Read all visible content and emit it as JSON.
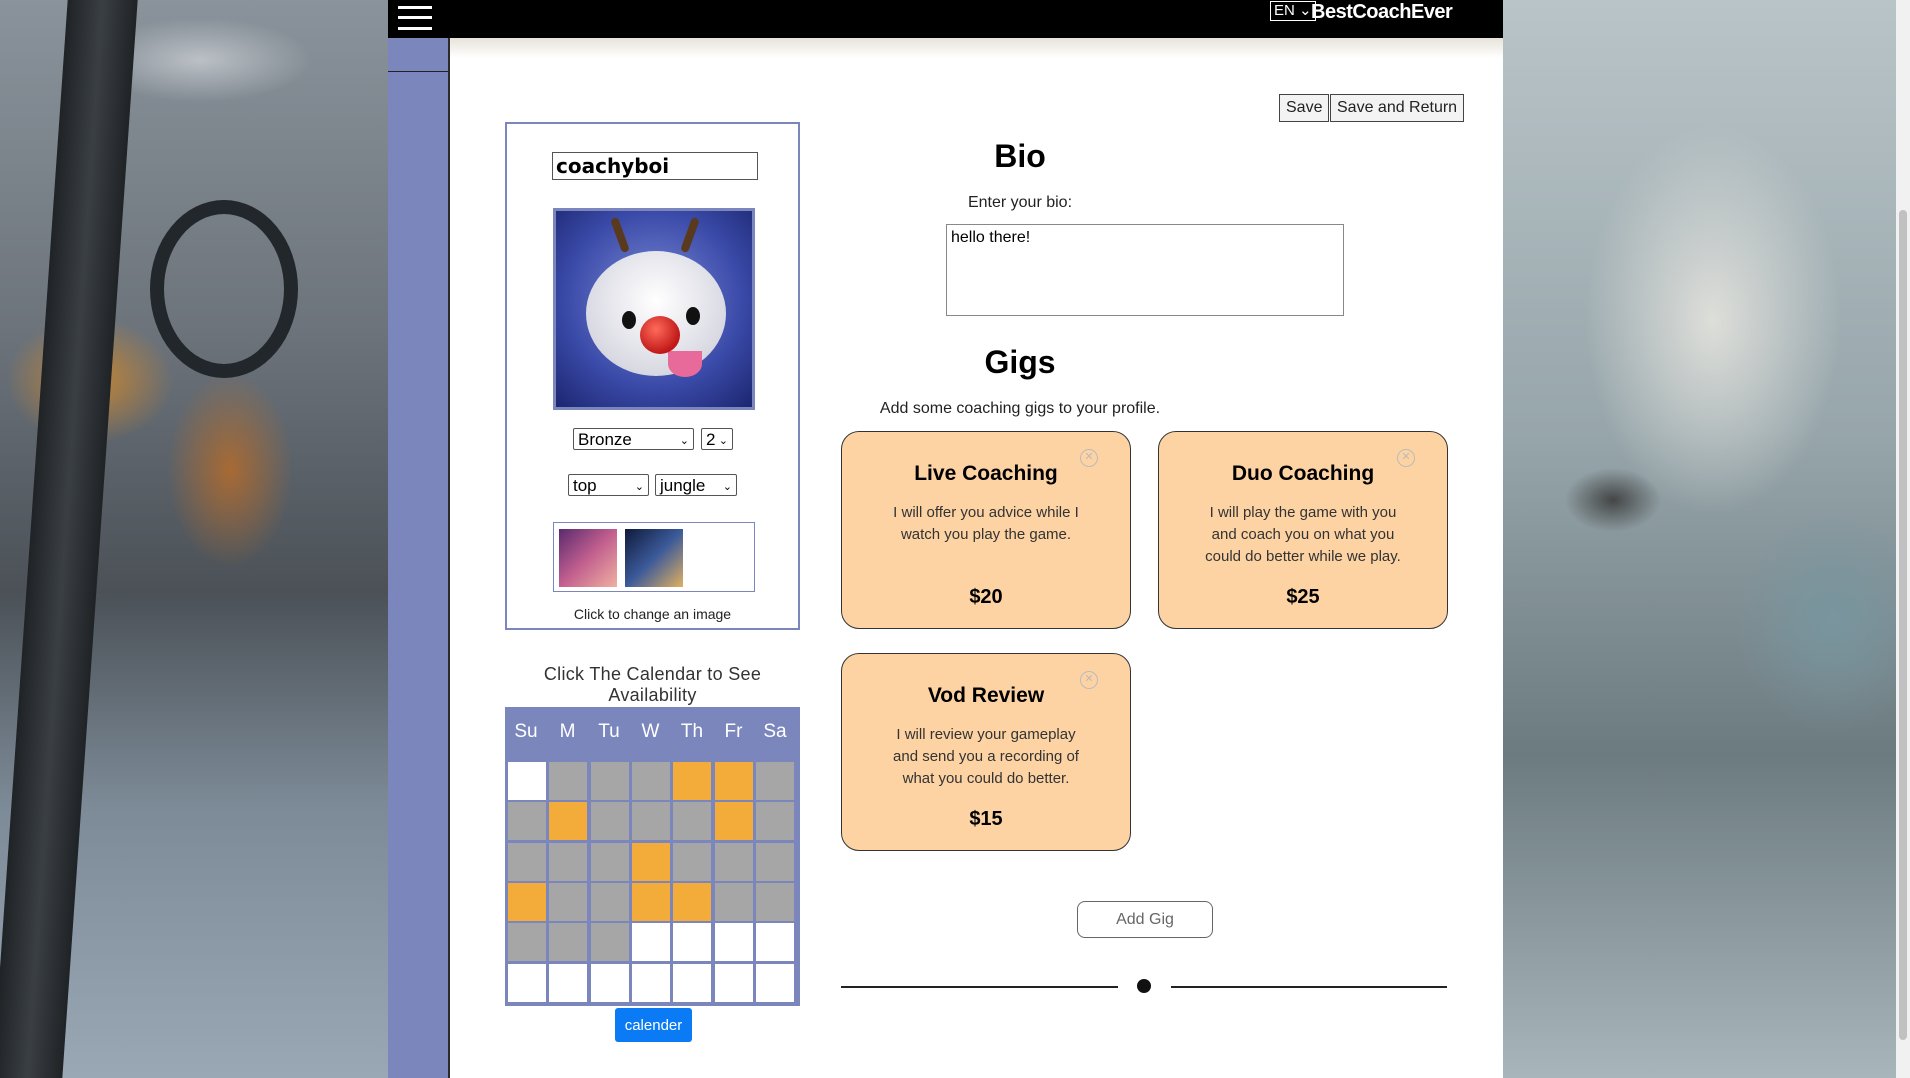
{
  "header": {
    "language": "EN",
    "brand": "BestCoachEver"
  },
  "actions": {
    "save": "Save",
    "save_and_return": "Save and Return"
  },
  "profile": {
    "username": "coachyboi",
    "rank": "Bronze",
    "division": "2",
    "role_primary": "top",
    "role_secondary": "jungle",
    "change_image_hint": "Click to change an image"
  },
  "calendar": {
    "title": "Click The Calendar to See Availability",
    "days": [
      "Su",
      "M",
      "Tu",
      "W",
      "Th",
      "Fr",
      "Sa"
    ],
    "grid": [
      [
        "free",
        "busy",
        "busy",
        "busy",
        "on",
        "on",
        "busy"
      ],
      [
        "busy",
        "on",
        "busy",
        "busy",
        "busy",
        "on",
        "busy"
      ],
      [
        "busy",
        "busy",
        "busy",
        "on",
        "busy",
        "busy",
        "busy"
      ],
      [
        "on",
        "busy",
        "busy",
        "on",
        "on",
        "busy",
        "busy"
      ],
      [
        "busy",
        "busy",
        "busy",
        "free",
        "free",
        "free",
        "free"
      ],
      [
        "free",
        "free",
        "free",
        "free",
        "free",
        "free",
        "free"
      ]
    ],
    "button": "calender",
    "colors": {
      "header": "#7b86bd",
      "on": "#f3ab3a",
      "busy": "#a6a6a6",
      "free": "#ffffff"
    }
  },
  "bio": {
    "heading": "Bio",
    "label": "Enter your bio:",
    "value": "hello there!"
  },
  "gigs": {
    "heading": "Gigs",
    "hint": "Add some coaching gigs to your profile.",
    "items": [
      {
        "title": "Live Coaching",
        "desc": "I will offer you advice while I watch you play the game.",
        "price": "$20"
      },
      {
        "title": "Duo Coaching",
        "desc": "I will play the game with you and coach you on what you could do better while we play.",
        "price": "$25"
      },
      {
        "title": "Vod Review",
        "desc": "I will review your gameplay and send you a recording of what you could do better.",
        "price": "$15"
      }
    ],
    "add_button": "Add Gig",
    "card_color": "#fdd3a4"
  }
}
